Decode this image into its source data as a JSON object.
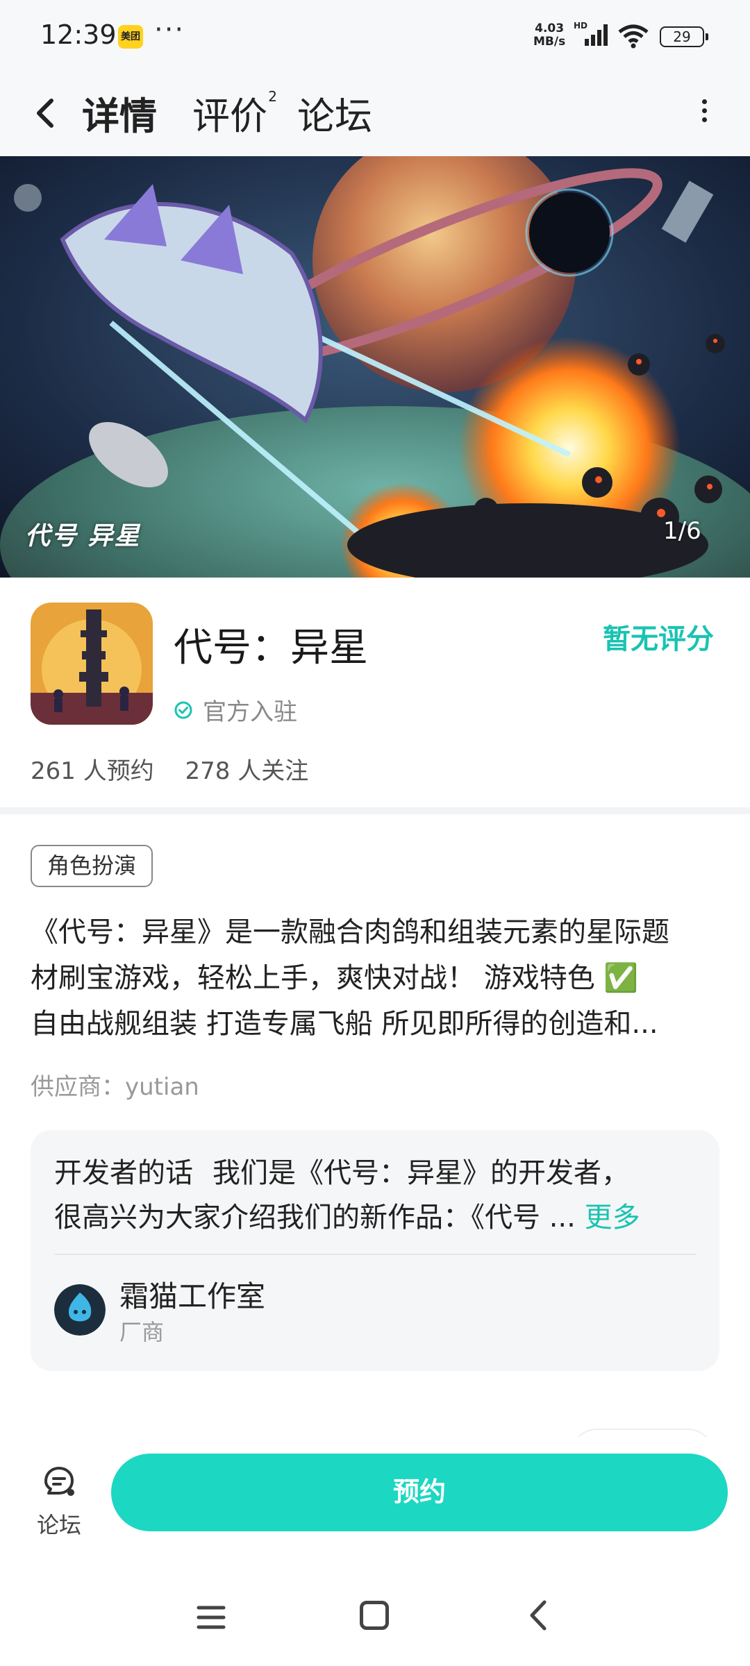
{
  "status_bar": {
    "time": "12:39",
    "app_badge": "美团",
    "dots": "···",
    "net_speed_value": "4.03",
    "net_speed_unit": "MB/s",
    "hd": "HD",
    "battery": "29"
  },
  "nav": {
    "tabs": [
      {
        "label": "详情",
        "active": true
      },
      {
        "label": "评价",
        "badge": "2"
      },
      {
        "label": "论坛"
      }
    ]
  },
  "banner": {
    "logo_text": "代号 异星",
    "counter": "1/6"
  },
  "game": {
    "title": "代号：异星",
    "rating": "暂无评分",
    "official": "官方入驻",
    "reservations": "261 人预约",
    "followers": "278 人关注",
    "genre_tag": "角色扮演",
    "description_lines": [
      "《代号：异星》是一款融合肉鸽和组装元素的星际题",
      "材刷宝游戏，轻松上手，爽快对战！ 游戏特色 ✅",
      "自由战舰组装 打造专属飞船 所见即所得的创造和..."
    ],
    "supplier": "供应商：yutian"
  },
  "developer": {
    "label": "开发者的话",
    "text_line1": "我们是《代号：异星》的开发者，",
    "text_line2": "很高兴为大家介绍我们的新作品：《代号 ...",
    "more": "更多",
    "studio_name": "霜猫工作室",
    "studio_role": "厂商"
  },
  "bottom_bar": {
    "forum_label": "论坛",
    "reserve_label": "预约"
  },
  "colors": {
    "accent": "#1cd7c2",
    "accent_text": "#19c3b3"
  },
  "icons": [
    "back-arrow-icon",
    "more-vertical-icon",
    "verified-check-icon",
    "forum-chat-icon",
    "menu-icon",
    "home-icon",
    "back-nav-icon"
  ]
}
